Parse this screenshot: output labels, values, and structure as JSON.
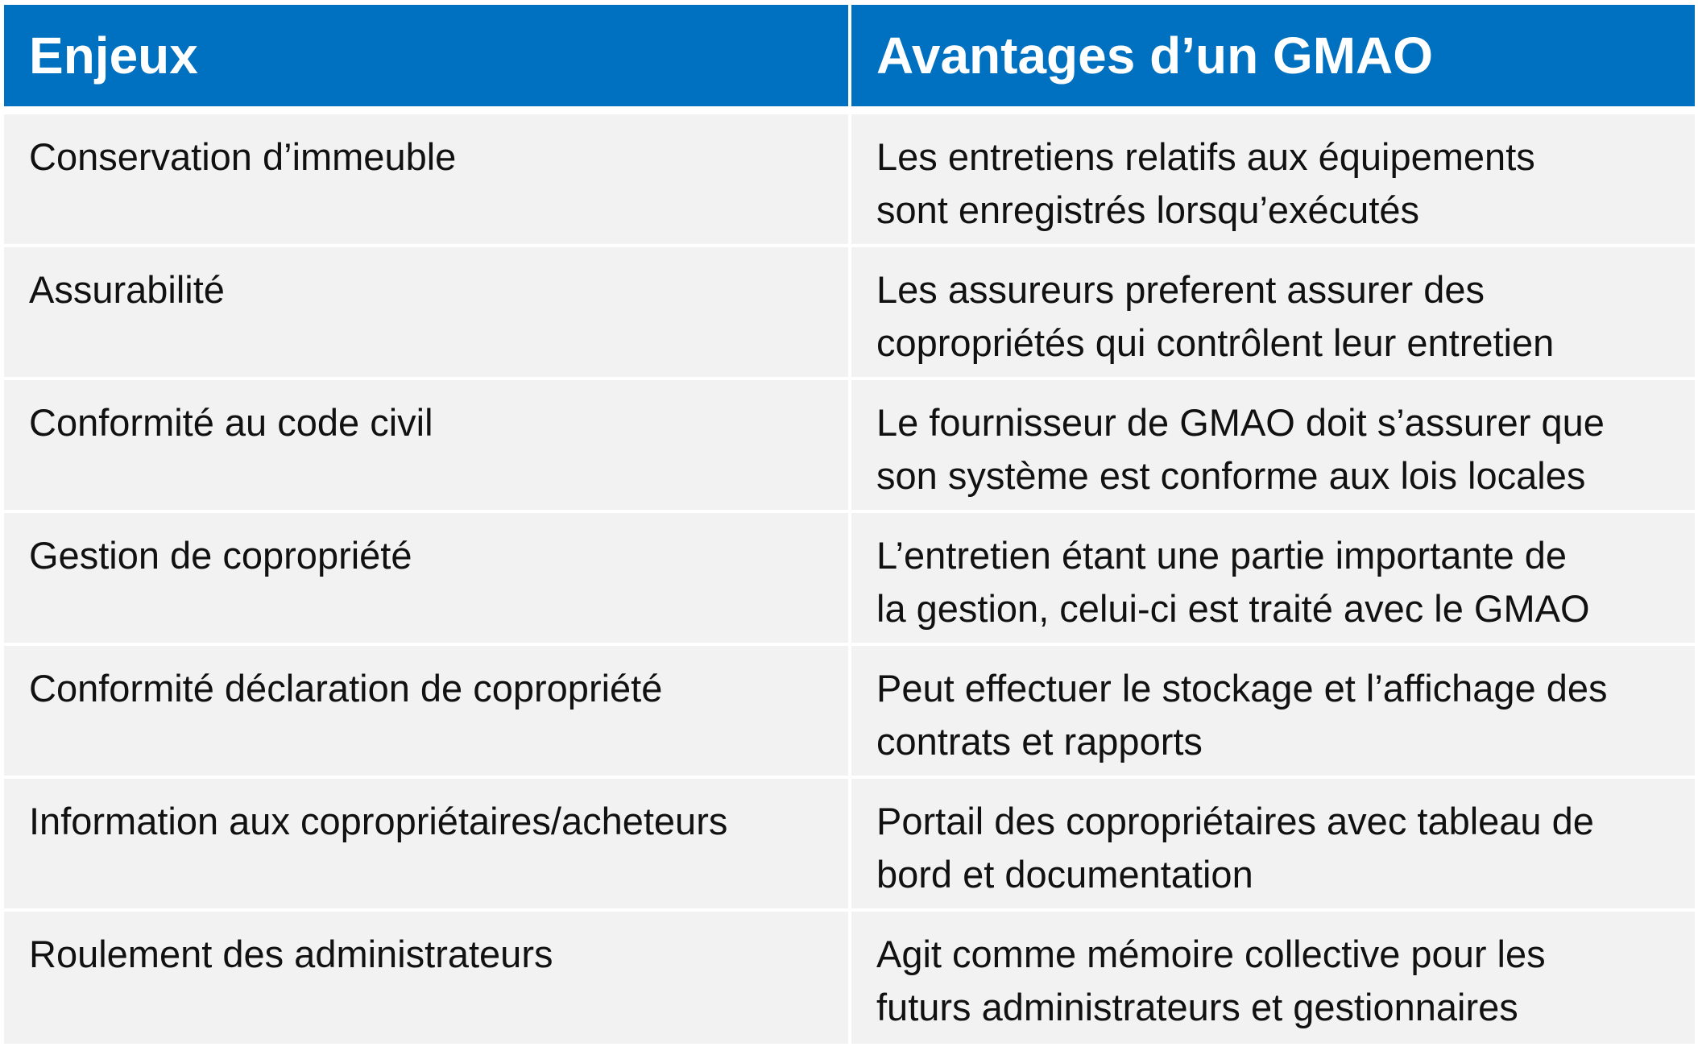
{
  "header": {
    "col1": "Enjeux",
    "col2": "Avantages d’un GMAO"
  },
  "rows": [
    {
      "enjeu": "Conservation d’immeuble",
      "avantage_line1": "Les entretiens relatifs aux équipements",
      "avantage_line2": "sont enregistrés lorsqu’exécutés"
    },
    {
      "enjeu": "Assurabilité",
      "avantage_line1": "Les assureurs preferent assurer des",
      "avantage_line2": "copropriétés qui contrôlent leur entretien"
    },
    {
      "enjeu": "Conformité au code civil",
      "avantage_line1": "Le fournisseur de GMAO doit s’assurer que",
      "avantage_line2": "son système est conforme aux lois locales"
    },
    {
      "enjeu": "Gestion de copropriété",
      "avantage_line1": "L’entretien étant une partie importante de",
      "avantage_line2": "la gestion, celui-ci est traité avec le GMAO"
    },
    {
      "enjeu": "Conformité déclaration de copropriété",
      "avantage_line1": "Peut effectuer le stockage et l’affichage des",
      "avantage_line2": "contrats et rapports"
    },
    {
      "enjeu": "Information aux copropriétaires/acheteurs",
      "avantage_line1": "Portail des copropriétaires avec tableau de",
      "avantage_line2": "bord et documentation"
    },
    {
      "enjeu": "Roulement des administrateurs",
      "avantage_line1": "Agit comme mémoire collective pour les",
      "avantage_line2": "futurs administrateurs et gestionnaires"
    }
  ],
  "colors": {
    "header_bg": "#0070c0",
    "header_text": "#ffffff",
    "row_bg": "#f2f2f2",
    "body_text": "#111111"
  }
}
